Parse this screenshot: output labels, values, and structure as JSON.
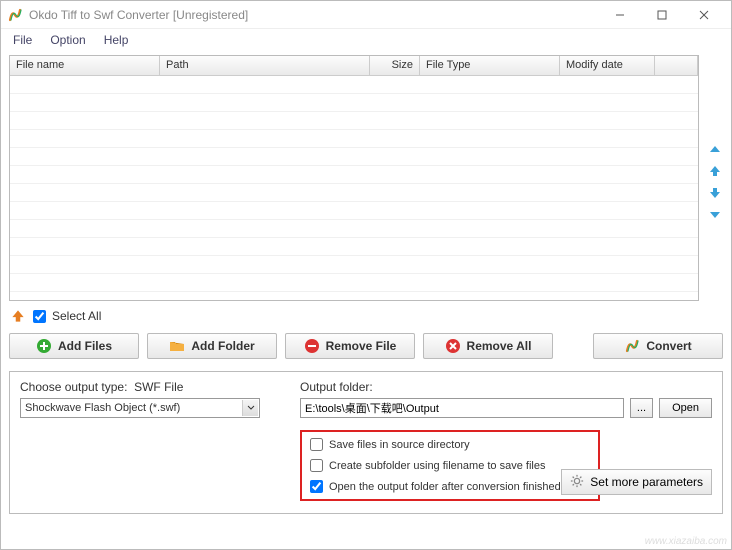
{
  "window": {
    "title": "Okdo Tiff to Swf Converter [Unregistered]"
  },
  "menu": {
    "file": "File",
    "option": "Option",
    "help": "Help"
  },
  "grid": {
    "cols": {
      "filename": "File name",
      "path": "Path",
      "size": "Size",
      "filetype": "File Type",
      "modify": "Modify date"
    }
  },
  "selectall": {
    "label": "Select All",
    "checked": true
  },
  "buttons": {
    "addfiles": "Add Files",
    "addfolder": "Add Folder",
    "removefile": "Remove File",
    "removeall": "Remove All",
    "convert": "Convert",
    "open": "Open",
    "browse": "...",
    "setmore": "Set more parameters"
  },
  "output": {
    "choose_label": "Choose output type:",
    "type_short": "SWF File",
    "type_long": "Shockwave Flash Object (*.swf)",
    "folder_label": "Output folder:",
    "folder_path": "E:\\tools\\桌面\\下载吧\\Output"
  },
  "options": {
    "save_source": {
      "label": "Save files in source directory",
      "checked": false
    },
    "create_subfolder": {
      "label": "Create subfolder using filename to save files",
      "checked": false
    },
    "open_folder": {
      "label": "Open the output folder after conversion finished",
      "checked": true
    }
  },
  "watermark": "www.xiazaiba.com"
}
